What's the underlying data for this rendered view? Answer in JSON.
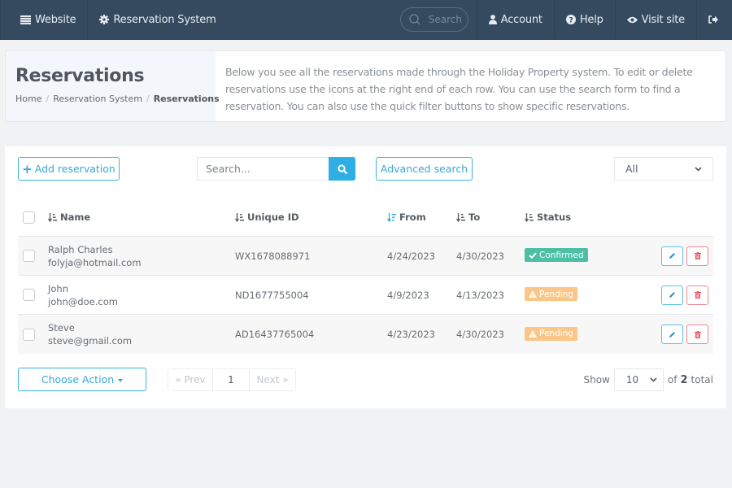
{
  "topnav": {
    "left": [
      {
        "label": "Website",
        "icon": "list-icon"
      },
      {
        "label": "Reservation System",
        "icon": "gear-icon"
      }
    ],
    "search_placeholder": "Search",
    "right": [
      {
        "label": "Account",
        "icon": "user-icon"
      },
      {
        "label": "Help",
        "icon": "question-circle-icon"
      },
      {
        "label": "Visit site",
        "icon": "eye-icon"
      }
    ],
    "logout_icon": "sign-out-icon"
  },
  "header": {
    "title": "Reservations",
    "breadcrumb": [
      "Home",
      "Reservation System",
      "Reservations"
    ],
    "description": "Below you see all the reservations made through the Holiday Property system. To edit or delete reservations use the icons at the right end of each row. You can use the search form to find a reservation. You can also use the quick filter buttons to show specific reservations."
  },
  "toolbar": {
    "add_label": "Add reservation",
    "search_placeholder": "Search...",
    "advanced_label": "Advanced search",
    "filter_selected": "All"
  },
  "table": {
    "columns": [
      "Name",
      "Unique ID",
      "From",
      "To",
      "Status"
    ],
    "rows": [
      {
        "name": "Ralph Charles",
        "email": "folyja@hotmail.com",
        "uid": "WX1678088971",
        "from": "4/24/2023",
        "to": "4/30/2023",
        "status": "Confirmed"
      },
      {
        "name": "John",
        "email": "john@doe.com",
        "uid": "ND1677755004",
        "from": "4/9/2023",
        "to": "4/13/2023",
        "status": "Pending"
      },
      {
        "name": "Steve",
        "email": "steve@gmail.com",
        "uid": "AD16437765004",
        "from": "4/23/2023",
        "to": "4/30/2023",
        "status": "Pending"
      }
    ]
  },
  "footer": {
    "choose_action_label": "Choose Action",
    "prev_label": "« Prev",
    "current_page": "1",
    "next_label": "Next »",
    "show_label": "Show",
    "page_size": "10",
    "of_label": "of",
    "total_count": "2",
    "total_label": "total"
  },
  "colors": {
    "nav_bg": "#364a5f",
    "accent": "#2eaee2",
    "confirmed": "#4dbfa5",
    "pending": "#fbc687",
    "danger": "#e8505b"
  }
}
